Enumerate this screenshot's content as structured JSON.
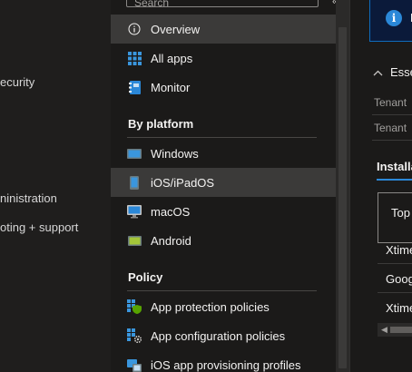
{
  "left_nav": {
    "items": [
      {
        "label": "ecurity"
      },
      {
        "label": "ninistration"
      },
      {
        "label": "oting + support"
      }
    ]
  },
  "menu": {
    "search_placeholder": "Search",
    "collapse_glyph": "«",
    "items_top": [
      {
        "label": "Overview",
        "icon": "info-circle-icon",
        "selected": true
      },
      {
        "label": "All apps",
        "icon": "grid-icon",
        "selected": false
      },
      {
        "label": "Monitor",
        "icon": "notebook-icon",
        "selected": false
      }
    ],
    "section_platform": "By platform",
    "items_platform": [
      {
        "label": "Windows",
        "icon": "windows-device-icon"
      },
      {
        "label": "iOS/iPadOS",
        "icon": "phone-icon"
      },
      {
        "label": "macOS",
        "icon": "monitor-icon"
      },
      {
        "label": "Android",
        "icon": "android-device-icon"
      }
    ],
    "section_policy": "Policy",
    "items_policy": [
      {
        "label": "App protection policies",
        "icon": "shield-grid-icon"
      },
      {
        "label": "App configuration policies",
        "icon": "gear-grid-icon"
      },
      {
        "label": "iOS app provisioning profiles",
        "icon": "provisioning-icon"
      }
    ]
  },
  "content": {
    "banner_text": "M",
    "banner_icon": "i",
    "essentials_label": "Esse",
    "tenant_label_1": "Tenant",
    "tenant_label_2": "Tenant",
    "tab_label": "Installa",
    "table_header": "Top",
    "rows": [
      "Xtime",
      "Goog",
      "Xtime"
    ]
  },
  "colors": {
    "accent": "#2b88d8",
    "selected_bg": "#3b3a39",
    "pane_bg": "#1b1a19"
  }
}
